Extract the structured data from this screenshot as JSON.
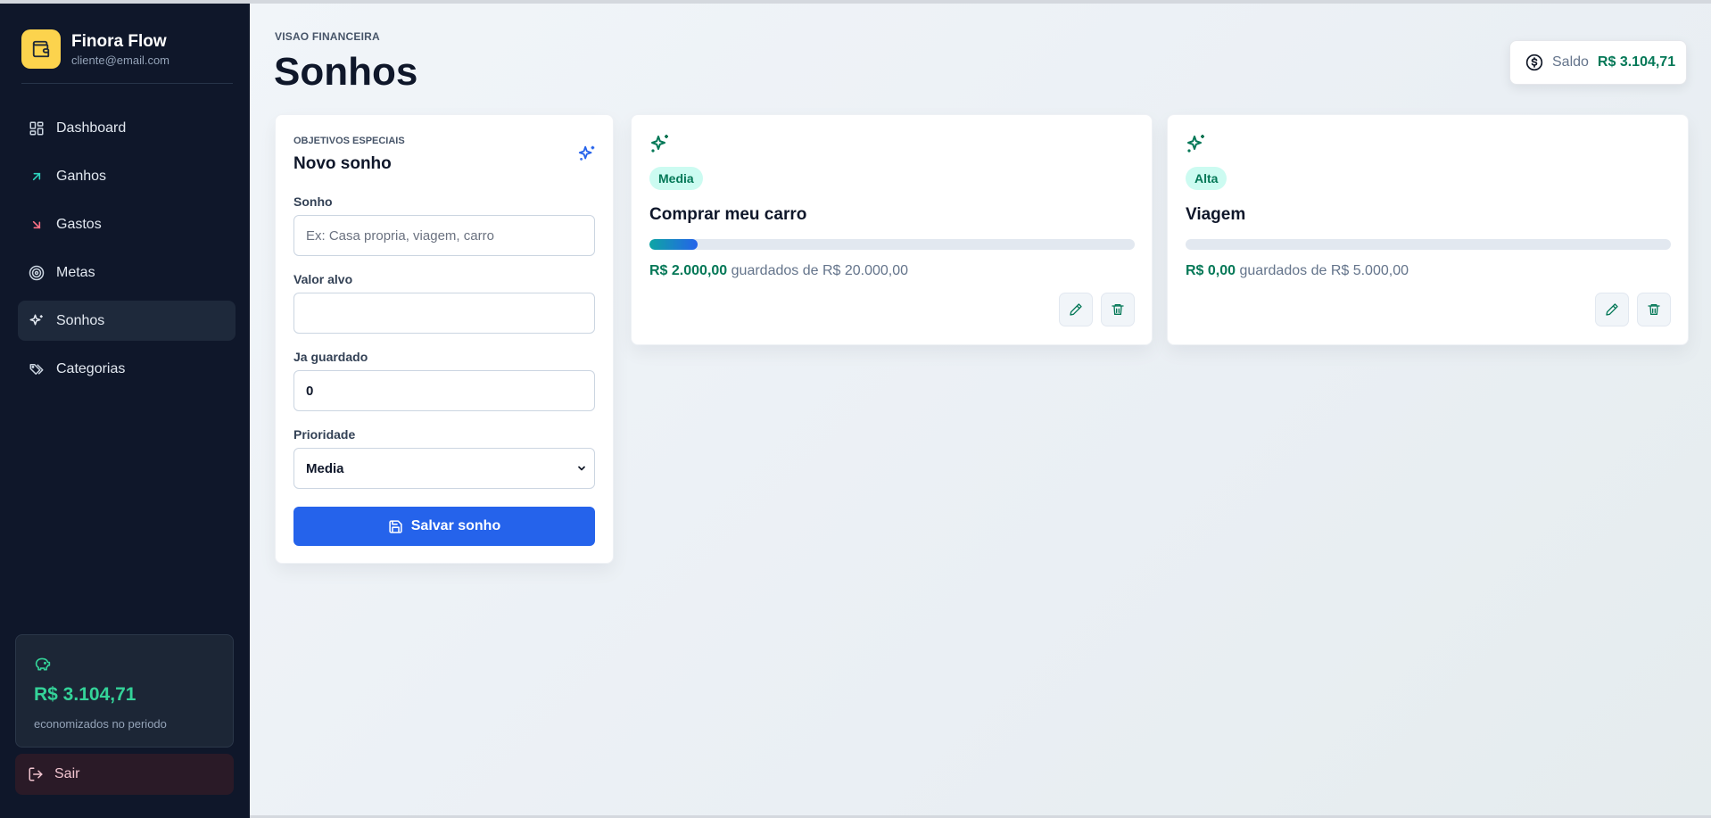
{
  "app": {
    "name": "Finora Flow",
    "email": "cliente@email.com"
  },
  "sidebar": {
    "items": [
      {
        "label": "Dashboard",
        "icon": "dashboard-icon",
        "active": false
      },
      {
        "label": "Ganhos",
        "icon": "arrow-up-right-icon",
        "active": false
      },
      {
        "label": "Gastos",
        "icon": "arrow-down-right-icon",
        "active": false
      },
      {
        "label": "Metas",
        "icon": "target-icon",
        "active": false
      },
      {
        "label": "Sonhos",
        "icon": "sparkles-icon",
        "active": true
      },
      {
        "label": "Categorias",
        "icon": "tags-icon",
        "active": false
      }
    ],
    "savings": {
      "amount": "R$ 3.104,71",
      "label": "economizados no periodo"
    },
    "logout_label": "Sair"
  },
  "header": {
    "eyebrow": "VISAO FINANCEIRA",
    "title": "Sonhos",
    "balance_label": "Saldo",
    "balance_value": "R$ 3.104,71"
  },
  "form": {
    "eyebrow": "OBJETIVOS ESPECIAIS",
    "title": "Novo sonho",
    "dream_label": "Sonho",
    "dream_placeholder": "Ex: Casa propria, viagem, carro",
    "dream_value": "",
    "target_label": "Valor alvo",
    "target_value": "",
    "saved_label": "Ja guardado",
    "saved_value": "0",
    "priority_label": "Prioridade",
    "priority_value": "Media",
    "save_label": "Salvar sonho"
  },
  "dreams": [
    {
      "priority": "Media",
      "title": "Comprar meu carro",
      "saved": "R$ 2.000,00",
      "saved_text": "guardados de",
      "target": "R$ 20.000,00",
      "progress": 0.1
    },
    {
      "priority": "Alta",
      "title": "Viagem",
      "saved": "R$ 0,00",
      "saved_text": "guardados de",
      "target": "R$ 5.000,00",
      "progress": 0
    }
  ],
  "colors": {
    "sidebar_bg": "#0f172a",
    "accent_blue": "#2563eb",
    "accent_green": "#047857",
    "savings_green": "#34d399",
    "badge_bg": "#ccfbf1",
    "brand_yellow": "#fcd34d"
  }
}
